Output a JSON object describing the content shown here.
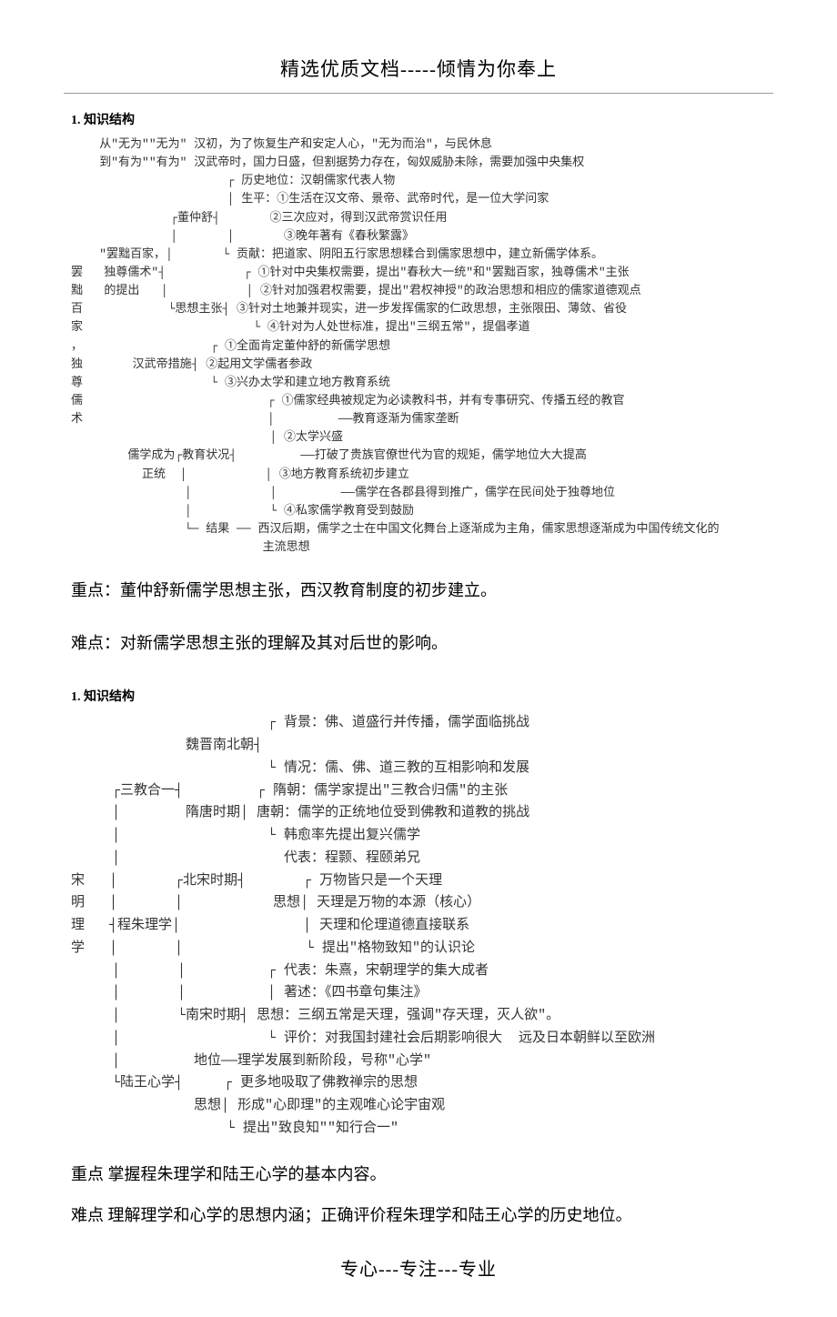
{
  "header": "精选优质文档-----倾情为你奉上",
  "footer": "专心---专注---专业",
  "diagram1": {
    "title": "1. 知识结构",
    "root": "罢黜百家，独尊儒术",
    "line_from": "从\"无为\"\"无为\" 汉初，为了恢复生产和安定人心，\"无为而治\"，与民休息",
    "line_to": "到\"有为\"\"有为\" 汉武帝时，国力日盛，但割据势力存在，匈奴威胁未除，需要加强中央集权",
    "item1_label": "\"罢黜百家，独尊儒术\" 的提出",
    "dong_label": "董仲舒",
    "dong_a": "历史地位：汉朝儒家代表人物",
    "dong_b": "生平：①生活在汉文帝、景帝、武帝时代，是一位大学问家",
    "dong_b2": "②三次应对，得到汉武帝赏识任用",
    "dong_b3": "③晚年著有《春秋繁露》",
    "dong_c": "贡献：把道家、阴阳五行家思想糅合到儒家思想中，建立新儒学体系。",
    "sixiang_label": "思想主张",
    "sx1": "①针对中央集权需要，提出\"春秋大一统\"和\"罢黜百家，独尊儒术\"主张",
    "sx2": "②针对加强君权需要，提出\"君权神授\"的政治思想和相应的儒家道德观点",
    "sx3": "③针对土地兼并现实，进一步发挥儒家的仁政思想，主张限田、薄敛、省役",
    "sx4": "④针对为人处世标准，提出\"三纲五常\"，提倡孝道",
    "wudi_label": "汉武帝措施",
    "wudi1": "①全面肯定董仲舒的新儒学思想",
    "wudi2": "②起用文学儒者参政",
    "wudi3": "③兴办太学和建立地方教育系统",
    "ruxue_label": "儒学成为正统",
    "jiaoyu_label": "教育状况",
    "jy1": "①儒家经典被规定为必读教科书，并有专事研究、传播五经的教官",
    "jy1b": "——教育逐渐为儒家垄断",
    "jy2": "②太学兴盛",
    "jy2b": "——打破了贵族官僚世代为官的规矩，儒学地位大大提高",
    "jy3": "③地方教育系统初步建立",
    "jy3b": "——儒学在各郡县得到推广，儒学在民间处于独尊地位",
    "jy4": "④私家儒学教育受到鼓励",
    "jieguo_label": "结果",
    "jieguo": "西汉后期，儒学之士在中国文化舞台上逐渐成为主角，儒家思想逐渐成为中国传统文化的",
    "jieguo2": "主流思想"
  },
  "mid_text1": "重点：董仲舒新儒学思想主张，西汉教育制度的初步建立。",
  "mid_text2": "难点：对新儒学思想主张的理解及其对后世的影响。",
  "diagram2": {
    "title": "1. 知识结构",
    "root": "宋明理学",
    "b1_label": "三教合一",
    "wj_label": "魏晋南北朝",
    "wj1": "背景：佛、道盛行并传播，儒学面临挑战",
    "wj2": "情况：儒、佛、道三教的互相影响和发展",
    "st_label": "隋唐时期",
    "st1": "隋朝：儒学家提出\"三教合归儒\"的主张",
    "st2": "唐朝：儒学的正统地位受到佛教和道教的挑战",
    "st3": "韩愈率先提出复兴儒学",
    "b2_label": "程朱理学",
    "bs_label": "北宋时期",
    "bs_daibiao": "代表：程颢、程颐弟兄",
    "bs_sixiang_label": "思想",
    "bs_sx1": "万物皆只是一个天理",
    "bs_sx2": "天理是万物的本源（核心）",
    "bs_sx3": "天理和伦理道德直接联系",
    "bs_sx4": "提出\"格物致知\"的认识论",
    "ns_label": "南宋时期",
    "ns1": "代表：朱熹，宋朝理学的集大成者",
    "ns2": "著述：《四书章句集注》",
    "ns3": "思想：三纲五常是天理，强调\"存天理，灭人欲\"。",
    "ns4": "评价：对我国封建社会后期影响很大  远及日本朝鲜以至欧洲",
    "b3_label": "陆王心学",
    "lw_diwei": "地位——理学发展到新阶段，号称\"心学\"",
    "lw_sx_label": "思想",
    "lw1": "更多地吸取了佛教禅宗的思想",
    "lw2": "形成\"心即理\"的主观唯心论宇宙观",
    "lw3": "提出\"致良知\"\"知行合一\""
  },
  "end_text1": "重点    掌握程朱理学和陆王心学的基本内容。",
  "end_text2": "难点    理解理学和心学的思想内涵；正确评价程朱理学和陆王心学的历史地位。"
}
